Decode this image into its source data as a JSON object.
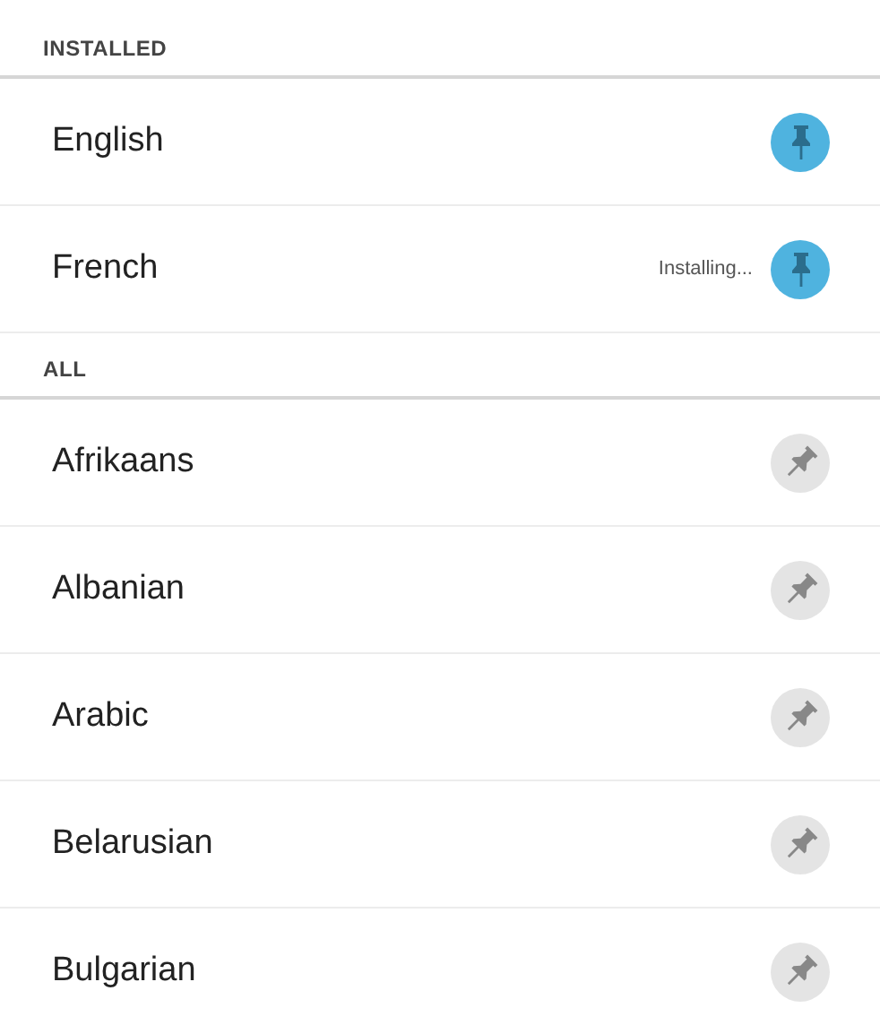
{
  "sections": [
    {
      "title": "INSTALLED",
      "languages": [
        {
          "name": "English",
          "pinned": true
        },
        {
          "name": "French",
          "pinned": true,
          "status": "Installing..."
        }
      ]
    },
    {
      "title": "ALL",
      "languages": [
        {
          "name": "Afrikaans",
          "pinned": false
        },
        {
          "name": "Albanian",
          "pinned": false
        },
        {
          "name": "Arabic",
          "pinned": false
        },
        {
          "name": "Belarusian",
          "pinned": false
        },
        {
          "name": "Bulgarian",
          "pinned": false
        }
      ]
    }
  ]
}
